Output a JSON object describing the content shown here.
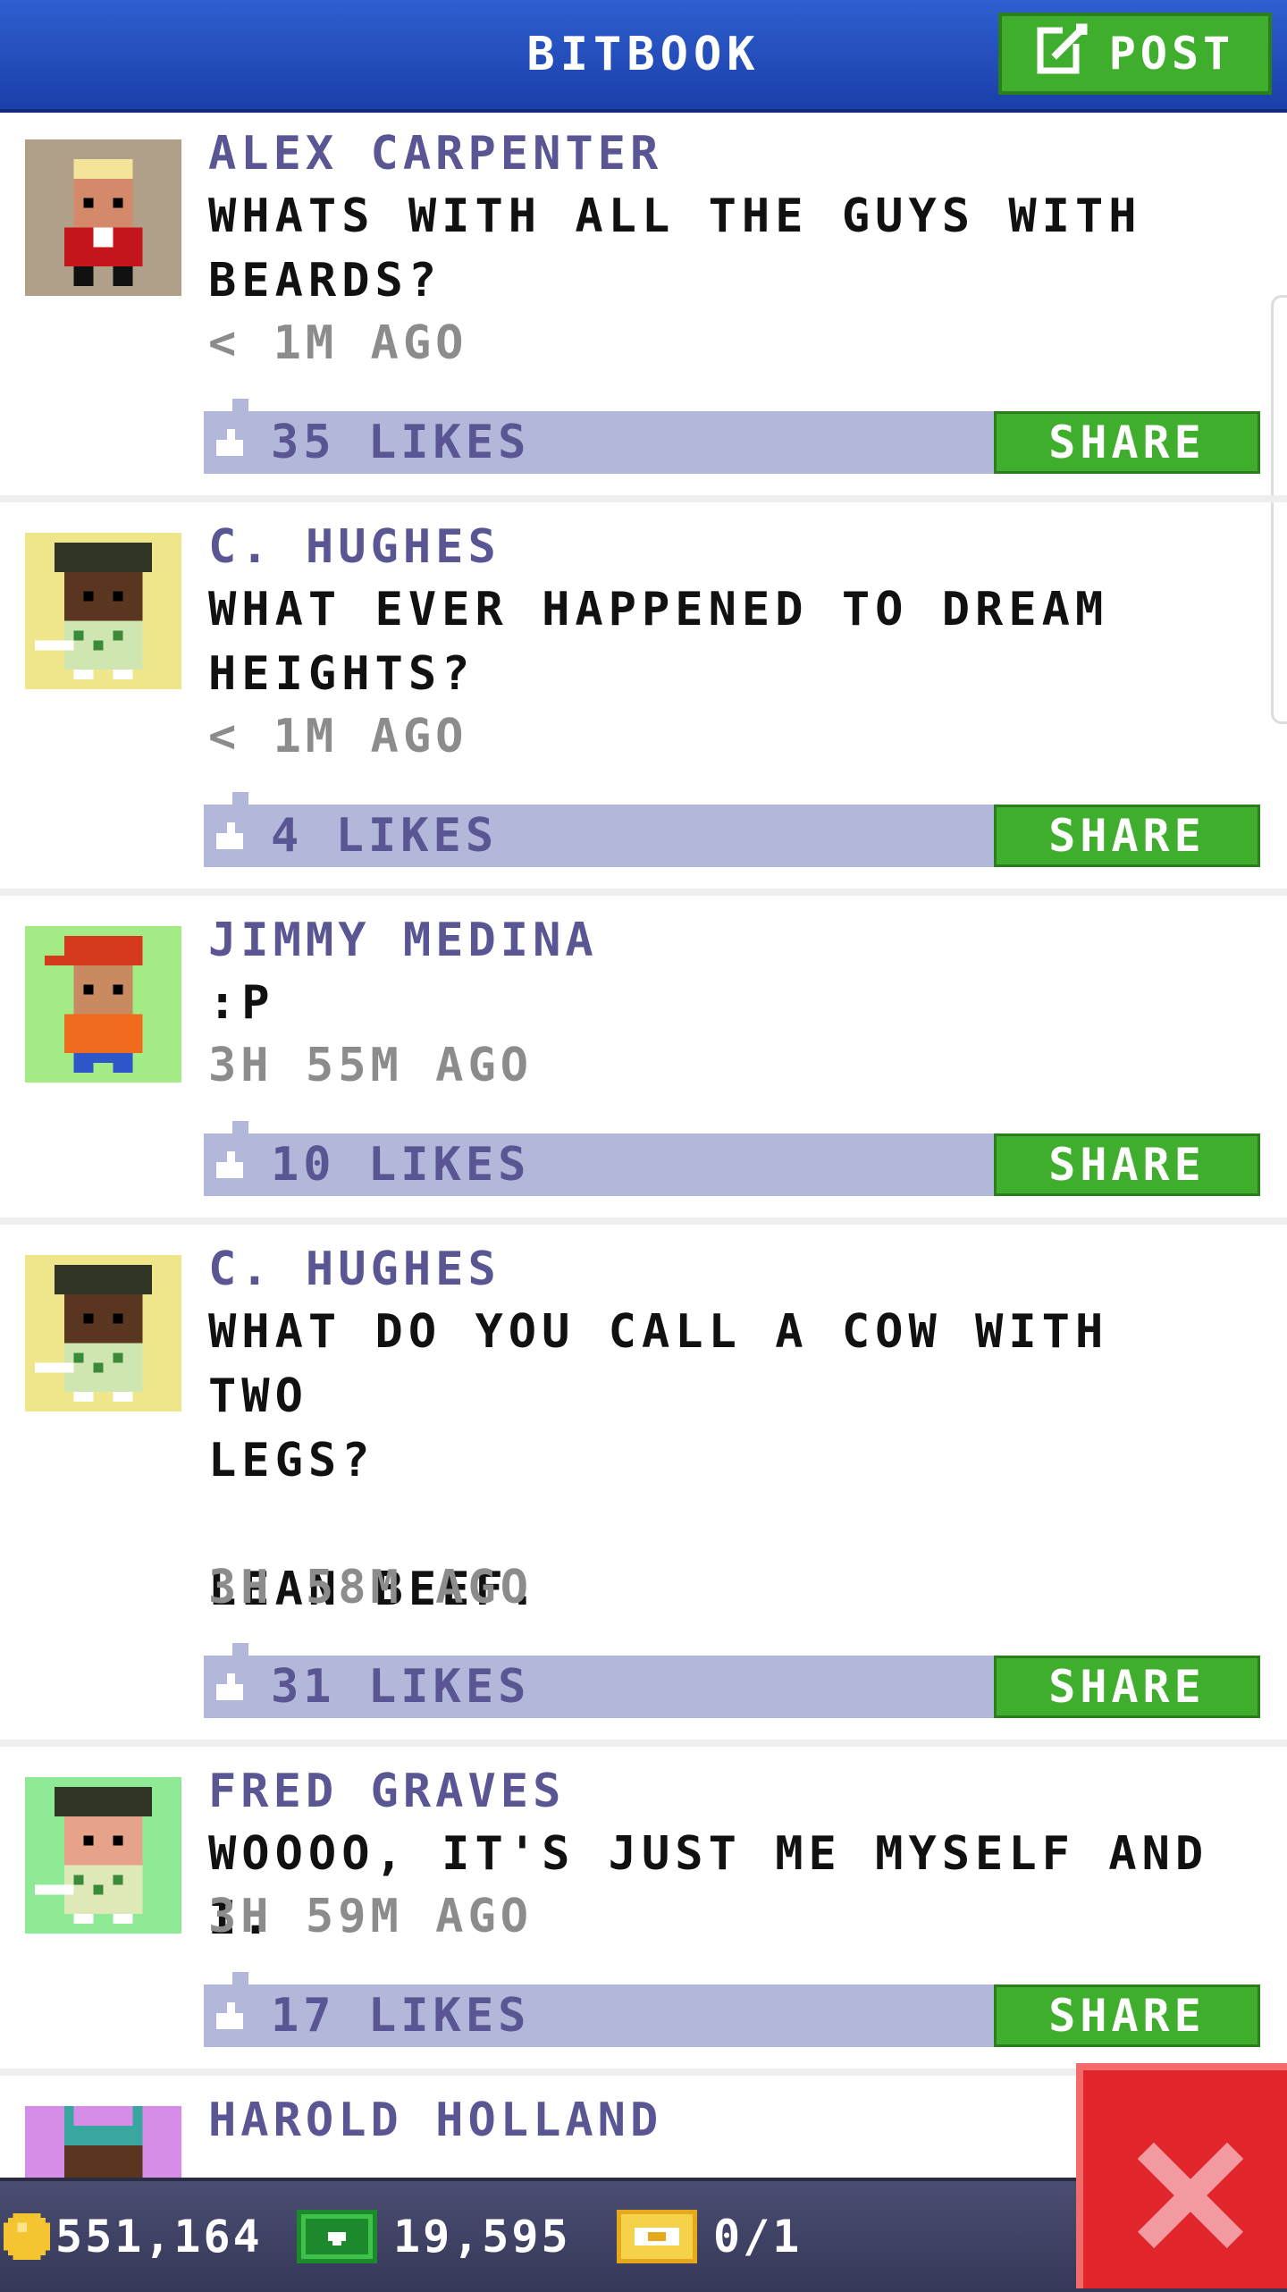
{
  "header": {
    "title": "BITBOOK",
    "post_label": "POST",
    "post_icon": "compose-icon"
  },
  "posts": [
    {
      "name": "ALEX CARPENTER",
      "message": "WHATS WITH ALL THE GUYS WITH\nBEARDS?",
      "time": "< 1M AGO",
      "likes": "35 LIKES",
      "share": "SHARE",
      "avatar_bg": "#b1a089"
    },
    {
      "name": "C. HUGHES",
      "message": "WHAT EVER HAPPENED TO DREAM\nHEIGHTS?",
      "time": "< 1M AGO",
      "likes": "4 LIKES",
      "share": "SHARE",
      "avatar_bg": "#efe58a"
    },
    {
      "name": "JIMMY MEDINA",
      "message": ":P",
      "time": "3H 55M AGO",
      "likes": "10 LIKES",
      "share": "SHARE",
      "avatar_bg": "#a3ec85"
    },
    {
      "name": "C. HUGHES",
      "message": "WHAT DO YOU CALL A COW WITH TWO\nLEGS?\n\nLEAN BEEF.",
      "time": "3H 58M AGO",
      "likes": "31 LIKES",
      "share": "SHARE",
      "avatar_bg": "#efe58a"
    },
    {
      "name": "FRED GRAVES",
      "message": "WOOOO, IT'S JUST ME MYSELF AND I.",
      "time": "3H 59M AGO",
      "likes": "17 LIKES",
      "share": "SHARE",
      "avatar_bg": "#8fea95"
    },
    {
      "name": "HAROLD HOLLAND",
      "avatar_bg": "#d68de8"
    }
  ],
  "bottom_bar": {
    "coins": "551,164",
    "bux": "19,595",
    "tickets": "0/1"
  },
  "colors": {
    "header": "#1f46b3",
    "accent_green": "#3fae2c",
    "likes_bar": "#b3b7d9",
    "name_text": "#5a5694",
    "close_red": "#e1262b"
  }
}
